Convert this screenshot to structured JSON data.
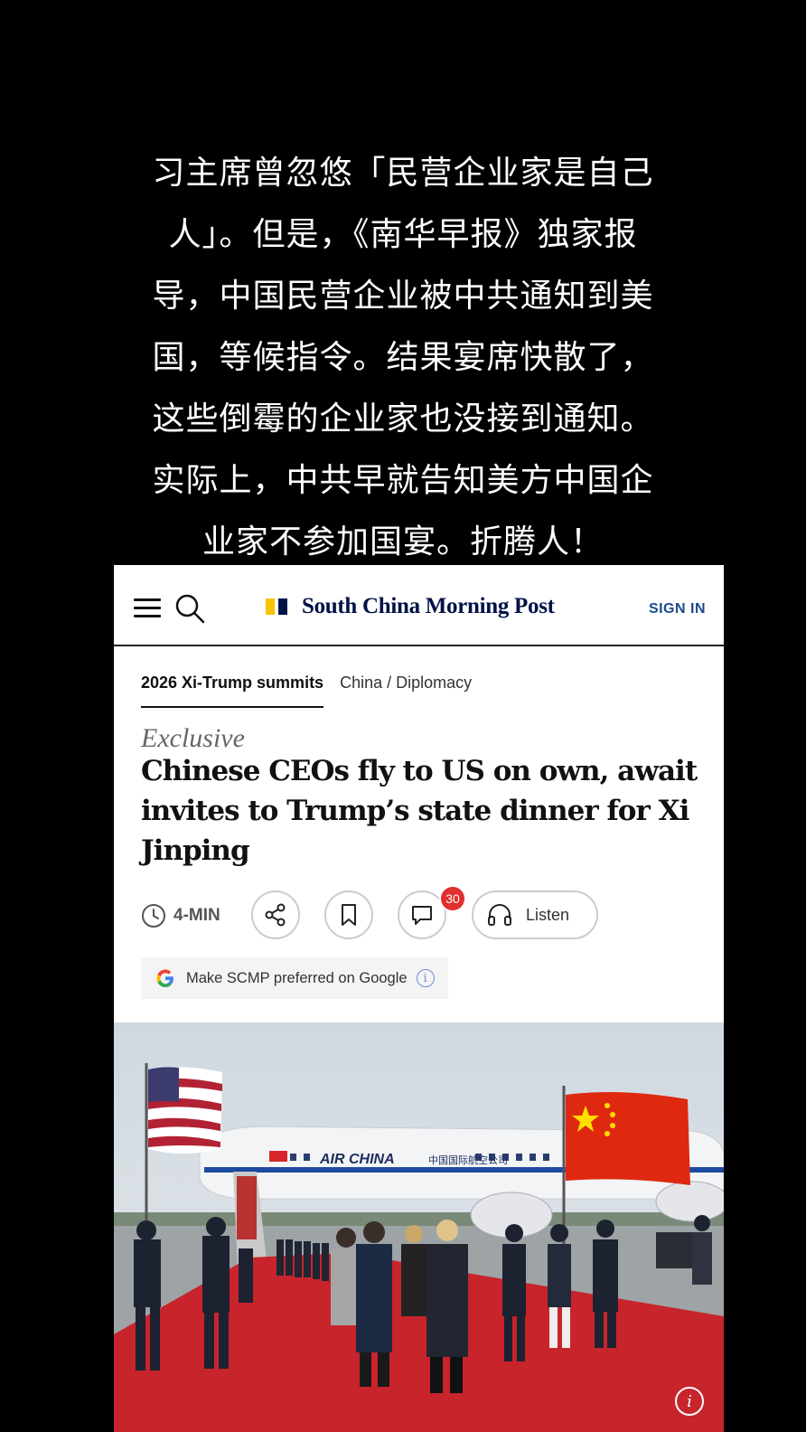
{
  "caption": {
    "lines": [
      "习主席曾忽悠「民营企业家是自己",
      "人」。但是，《南华早报》独家报",
      "导，中国民营企业被中共通知到美",
      "国，等候指令。结果宴席快散了，",
      "这些倒霉的企业家也没接到通知。",
      "实际上，中共早就告知美方中国企",
      "业家不参加国宴。折腾人！"
    ]
  },
  "header": {
    "logo_text": "South China Morning Post",
    "sign_in": "SIGN IN",
    "brand_colors": {
      "yellow": "#f9c300",
      "navy": "#001246"
    }
  },
  "breadcrumb": {
    "active": "2026 Xi-Trump summits",
    "path": "China / Diplomacy"
  },
  "article": {
    "label": "Exclusive",
    "headline": "Chinese CEOs fly to US on own, await invites to Trump’s state dinner for Xi Jinping",
    "read_time": "4-MIN",
    "comment_count": "30",
    "listen_label": "Listen",
    "google_pref": "Make SCMP preferred on Google"
  },
  "photo": {
    "plane_livery": "AIR CHINA",
    "plane_chinese": "中国国际航空公司",
    "info_glyph": "i"
  },
  "icons": [
    "hamburger-icon",
    "search-icon",
    "clock-icon",
    "share-icon",
    "bookmark-icon",
    "comment-icon",
    "headphones-icon",
    "google-icon",
    "info-icon"
  ]
}
